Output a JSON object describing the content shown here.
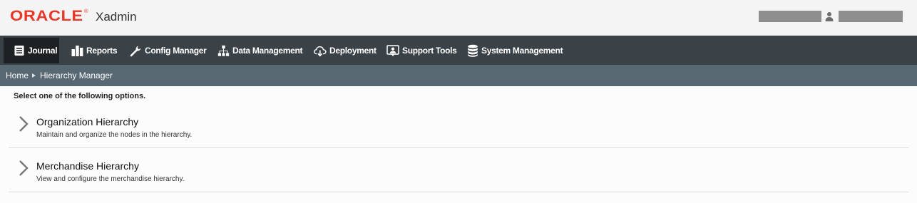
{
  "header": {
    "logo_text": "ORACLE",
    "logo_mark": "®",
    "app_name": "Xadmin",
    "user_icon": "user-icon"
  },
  "nav": {
    "items": [
      {
        "label": "Journal",
        "icon": "journal-icon",
        "active": true
      },
      {
        "label": "Reports",
        "icon": "bar-chart-icon"
      },
      {
        "label": "Config Manager",
        "icon": "wrench-icon"
      },
      {
        "label": "Data Management",
        "icon": "hierarchy-icon"
      },
      {
        "label": "Deployment",
        "icon": "cloud-download-icon"
      },
      {
        "label": "Support Tools",
        "icon": "support-icon"
      },
      {
        "label": "System Management",
        "icon": "database-icon"
      }
    ]
  },
  "breadcrumb": {
    "home": "Home",
    "current": "Hierarchy Manager"
  },
  "main": {
    "instructions": "Select one of the following options.",
    "options": [
      {
        "title": "Organization Hierarchy",
        "description": "Maintain and organize the nodes in the hierarchy."
      },
      {
        "title": "Merchandise Hierarchy",
        "description": "View and configure the merchandise hierarchy."
      }
    ]
  },
  "colors": {
    "brand_red": "#e8382a",
    "nav_bg": "#3a4248",
    "nav_active_bg": "#1e2124",
    "breadcrumb_bg": "#576873"
  }
}
